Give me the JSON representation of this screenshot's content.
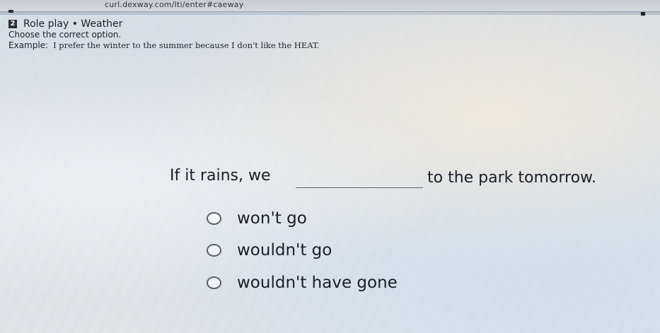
{
  "browser": {
    "url": "curl.dexway.com/lti/enter#caeway"
  },
  "header": {
    "badge": "2",
    "title": "Role play • Weather"
  },
  "instruction": "Choose the correct option.",
  "example": {
    "label": "Example:",
    "text": "I prefer the winter to the summer because I don't like the HEAT."
  },
  "question": {
    "before_blank": "If it rains, we",
    "after_blank": "to the park tomorrow."
  },
  "options": [
    {
      "label": "won't go",
      "selected": false
    },
    {
      "label": "wouldn't go",
      "selected": false
    },
    {
      "label": "wouldn't have gone",
      "selected": false
    }
  ]
}
